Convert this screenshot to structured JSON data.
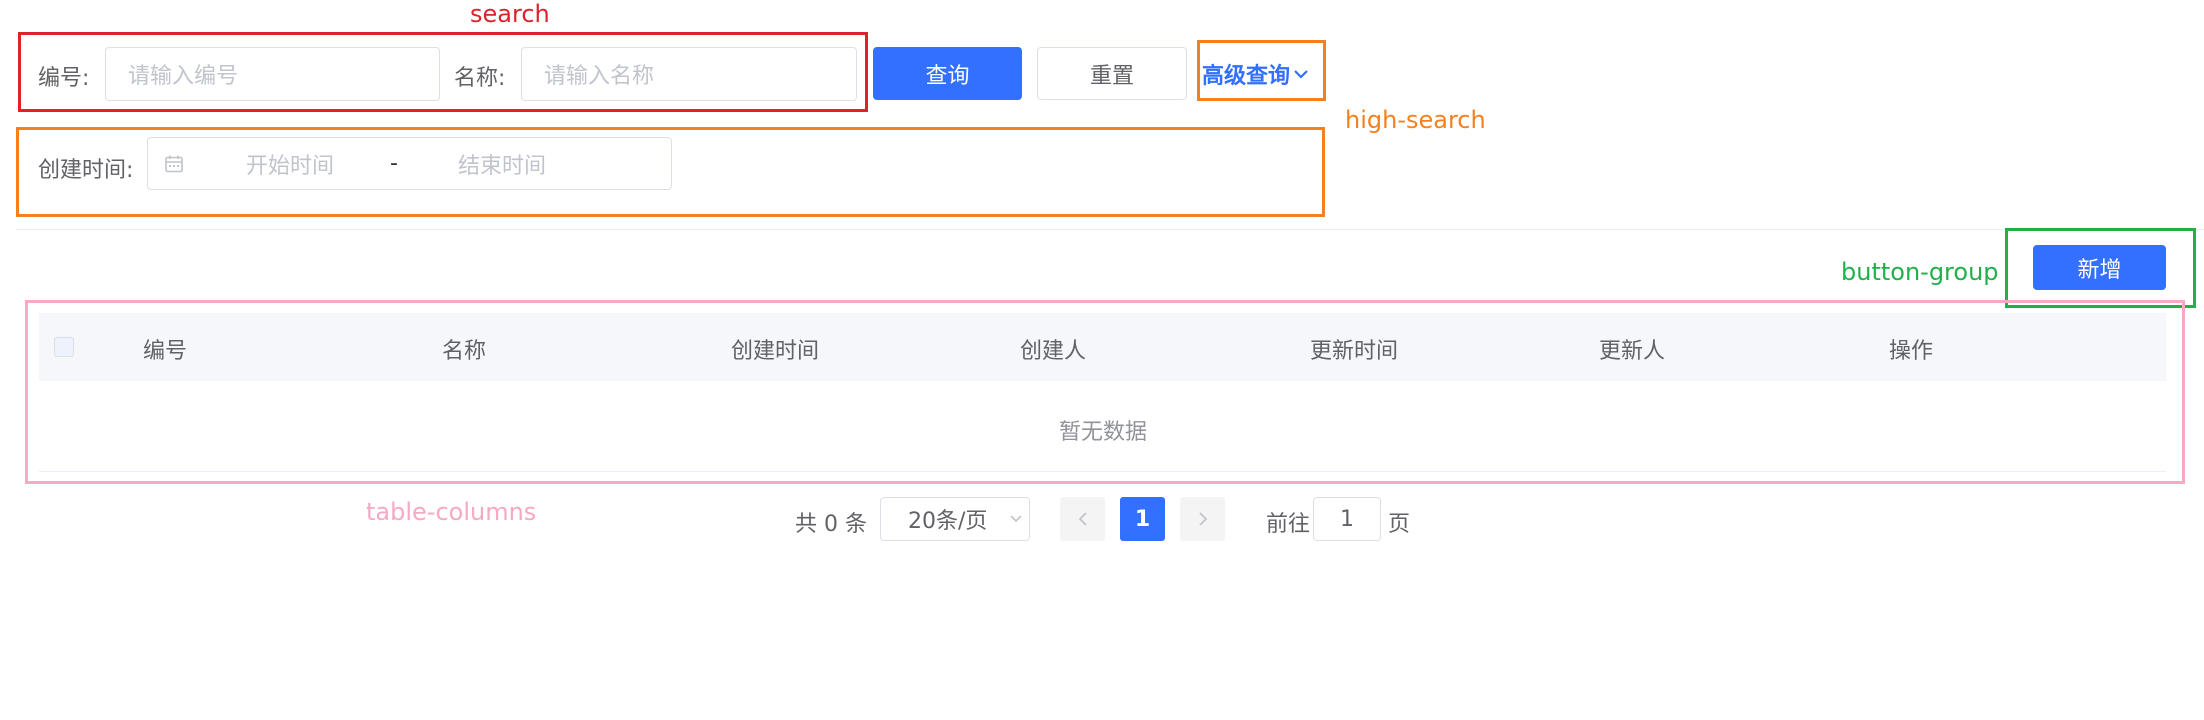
{
  "annotations": {
    "search": "search",
    "high_search": "high-search",
    "button_group": "button-group",
    "table_columns": "table-columns",
    "colors": {
      "search": "#e0202a",
      "high_search": "#f5801f",
      "button_group": "#22b04b",
      "table_columns": "#f7a8c4"
    }
  },
  "search": {
    "code_label": "编号:",
    "code_placeholder": "请输入编号",
    "name_label": "名称:",
    "name_placeholder": "请输入名称",
    "query_button": "查询",
    "reset_button": "重置",
    "advanced_link": "高级查询",
    "advanced_icon": "chevron-down-icon"
  },
  "high_search": {
    "created_label": "创建时间:",
    "calendar_icon": "calendar-icon",
    "start_placeholder": "开始时间",
    "separator": "-",
    "end_placeholder": "结束时间"
  },
  "toolbar": {
    "add_button": "新增"
  },
  "table": {
    "columns": [
      "编号",
      "名称",
      "创建时间",
      "创建人",
      "更新时间",
      "更新人",
      "操作"
    ],
    "empty_text": "暂无数据"
  },
  "pagination": {
    "total_text": "共 0 条",
    "page_size": "20条/页",
    "current_page": "1",
    "goto_label": "前往",
    "goto_value": "1",
    "page_suffix": "页"
  },
  "theme": {
    "primary": "#3370ff",
    "header_bg": "#f5f7fa",
    "border": "#dcdfe6"
  }
}
